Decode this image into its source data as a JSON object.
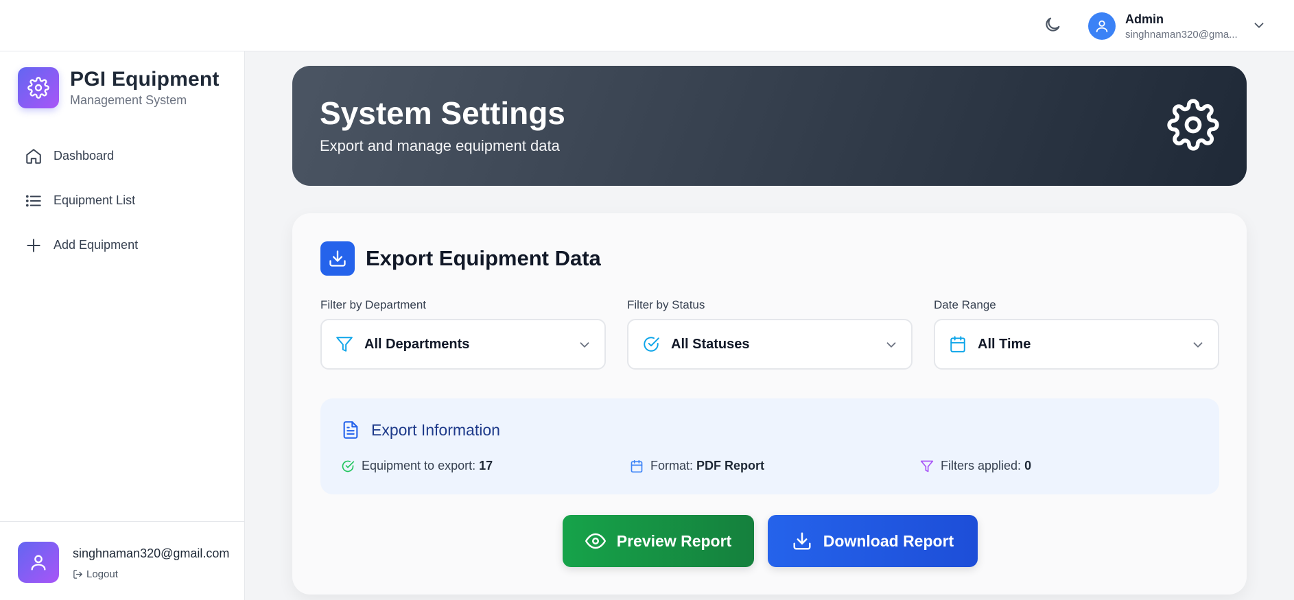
{
  "header": {
    "user_name": "Admin",
    "user_email": "singhnaman320@gma..."
  },
  "sidebar": {
    "brand_title": "PGI Equipment",
    "brand_subtitle": "Management System",
    "items": [
      {
        "label": "Dashboard",
        "icon": "home-icon"
      },
      {
        "label": "Equipment List",
        "icon": "list-icon"
      },
      {
        "label": "Add Equipment",
        "icon": "plus-icon"
      }
    ],
    "footer_email": "singhnaman320@gmail.com",
    "logout_label": "Logout"
  },
  "hero": {
    "title": "System Settings",
    "subtitle": "Export and manage equipment data"
  },
  "export": {
    "title": "Export Equipment Data",
    "filters": [
      {
        "label": "Filter by Department",
        "value": "All Departments",
        "icon": "filter-icon"
      },
      {
        "label": "Filter by Status",
        "value": "All Statuses",
        "icon": "check-circle-icon"
      },
      {
        "label": "Date Range",
        "value": "All Time",
        "icon": "calendar-icon"
      }
    ],
    "info": {
      "title": "Export Information",
      "count_label": "Equipment to export:",
      "count_value": "17",
      "format_label": "Format:",
      "format_value": "PDF Report",
      "filters_label": "Filters applied:",
      "filters_value": "0"
    },
    "preview_label": "Preview Report",
    "download_label": "Download Report"
  },
  "colors": {
    "accent_blue": "#2563eb",
    "accent_green": "#16a34a",
    "brand_gradient_start": "#6366f1",
    "brand_gradient_end": "#a855f7",
    "hero_dark": "#1f2937"
  }
}
